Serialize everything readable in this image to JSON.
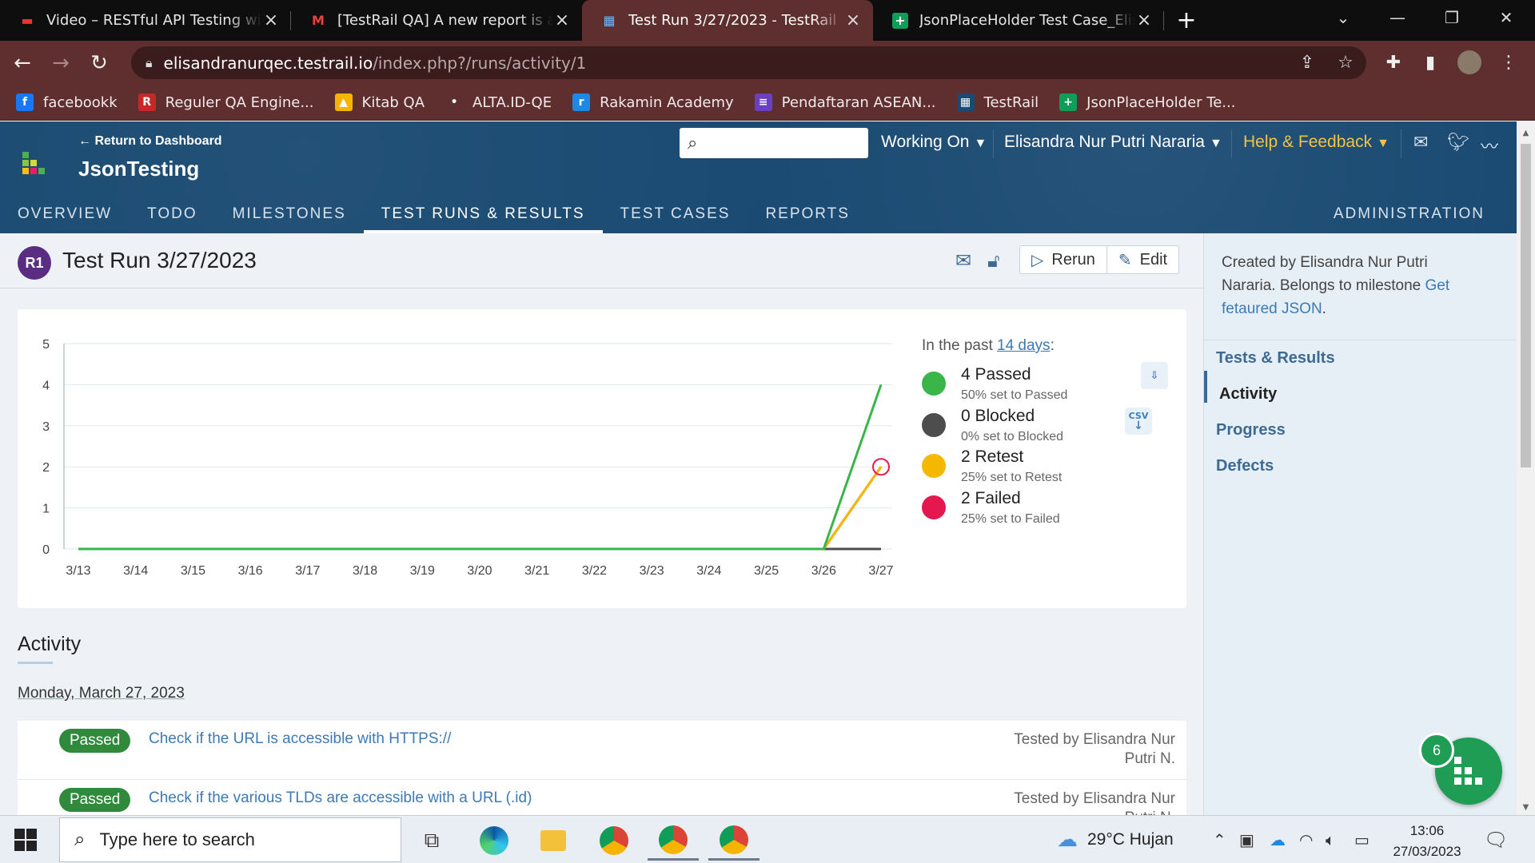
{
  "browser": {
    "tabs": [
      {
        "title": "Video – RESTful API Testing with P",
        "icon": "video-icon"
      },
      {
        "title": "[TestRail QA] A new report is avai",
        "icon": "gmail-icon"
      },
      {
        "title": "Test Run 3/27/2023 - TestRail",
        "icon": "testrail-icon",
        "active": true
      },
      {
        "title": "JsonPlaceHolder Test Case_Elisan",
        "icon": "sheets-icon"
      }
    ],
    "url_host": "elisandranurqec.testrail.io",
    "url_path": "/index.php?/runs/activity/1",
    "bookmarks": [
      {
        "label": "facebookk",
        "color": "#1877f2",
        "glyph": "f"
      },
      {
        "label": "Reguler QA Engine...",
        "color": "#c62828",
        "glyph": "R"
      },
      {
        "label": "Kitab QA",
        "color": "#f4b400",
        "glyph": "▲"
      },
      {
        "label": "ALTA.ID-QE",
        "color": "#5f2f2f",
        "glyph": "•"
      },
      {
        "label": "Rakamin Academy",
        "color": "#1e88e5",
        "glyph": "r"
      },
      {
        "label": "Pendaftaran ASEAN...",
        "color": "#6a3fc1",
        "glyph": "≡"
      },
      {
        "label": "TestRail",
        "color": "#1a4a72",
        "glyph": "▦"
      },
      {
        "label": "JsonPlaceHolder Te...",
        "color": "#0f9d58",
        "glyph": "+"
      }
    ]
  },
  "header": {
    "return_link": "← Return to Dashboard",
    "project": "JsonTesting",
    "working_on": "Working On",
    "user": "Elisandra Nur Putri Nararia",
    "help": "Help & Feedback",
    "nav": [
      "OVERVIEW",
      "TODO",
      "MILESTONES",
      "TEST RUNS & RESULTS",
      "TEST CASES",
      "REPORTS"
    ],
    "active_nav": "TEST RUNS & RESULTS",
    "admin": "ADMINISTRATION"
  },
  "run": {
    "badge": "R1",
    "title": "Test Run 3/27/2023",
    "rerun": "Rerun",
    "edit": "Edit"
  },
  "legend": {
    "intro_prefix": "In the past ",
    "intro_link": "14 days",
    "intro_suffix": ":",
    "items": [
      {
        "label": "4 Passed",
        "sub": "50% set to Passed",
        "color": "#3ab54a"
      },
      {
        "label": "0 Blocked",
        "sub": "0% set to Blocked",
        "color": "#4d4d4d"
      },
      {
        "label": "2 Retest",
        "sub": "25% set to Retest",
        "color": "#f5b800"
      },
      {
        "label": "2 Failed",
        "sub": "25% set to Failed",
        "color": "#e4174f"
      }
    ],
    "csv_label": "CSV"
  },
  "chart_data": {
    "type": "line",
    "x": [
      "3/13",
      "3/14",
      "3/15",
      "3/16",
      "3/17",
      "3/18",
      "3/19",
      "3/20",
      "3/21",
      "3/22",
      "3/23",
      "3/24",
      "3/25",
      "3/26",
      "3/27"
    ],
    "ylim": [
      0,
      5
    ],
    "yticks": [
      "0",
      "1",
      "2",
      "3",
      "4",
      "5"
    ],
    "grid": true,
    "series": [
      {
        "name": "Passed",
        "color": "#3ab54a",
        "values": [
          0,
          0,
          0,
          0,
          0,
          0,
          0,
          0,
          0,
          0,
          0,
          0,
          0,
          0,
          4
        ]
      },
      {
        "name": "Blocked",
        "color": "#4d4d4d",
        "values": [
          0,
          0,
          0,
          0,
          0,
          0,
          0,
          0,
          0,
          0,
          0,
          0,
          0,
          0,
          0
        ]
      },
      {
        "name": "Retest",
        "color": "#f5b800",
        "values": [
          0,
          0,
          0,
          0,
          0,
          0,
          0,
          0,
          0,
          0,
          0,
          0,
          0,
          0,
          2
        ]
      },
      {
        "name": "Failed",
        "color": "#e4174f",
        "values": [
          0,
          0,
          0,
          0,
          0,
          0,
          0,
          0,
          0,
          0,
          0,
          0,
          0,
          0,
          2
        ]
      }
    ]
  },
  "activity": {
    "heading": "Activity",
    "date": "Monday, March 27, 2023",
    "rows": [
      {
        "status": "Passed",
        "title": "Check if the URL is accessible with HTTPS://",
        "by": "Tested by Elisandra Nur Putri N."
      },
      {
        "status": "Passed",
        "title": "Check if the various TLDs are accessible with a URL (.id)",
        "by": "Tested by Elisandra Nur Putri N."
      }
    ]
  },
  "sidebar": {
    "created_by": "Created by Elisandra Nur Putri Nararia. Belongs to milestone ",
    "milestone": "Get fetaured JSON",
    "period": ".",
    "links": [
      "Tests & Results",
      "Activity",
      "Progress",
      "Defects"
    ],
    "active": "Activity"
  },
  "fab_count": "6",
  "taskbar": {
    "search_placeholder": "Type here to search",
    "weather": "29°C  Hujan",
    "time": "13:06",
    "date": "27/03/2023"
  }
}
